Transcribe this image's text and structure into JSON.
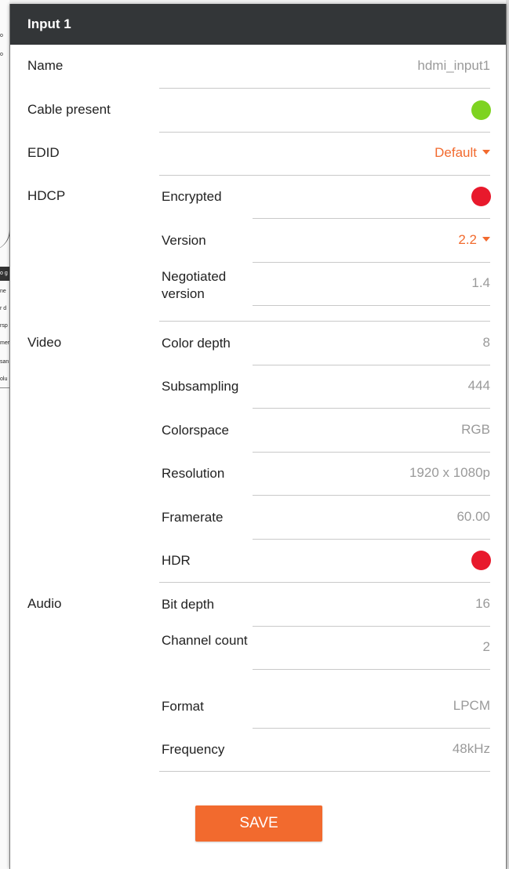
{
  "background": {
    "fragments": [
      "o",
      "o",
      "o g",
      "ne",
      "r d",
      "rsp",
      "mer",
      "san",
      "olu"
    ]
  },
  "panel": {
    "title": "Input 1"
  },
  "fields": {
    "name": {
      "label": "Name",
      "value": "hdmi_input1"
    },
    "cable_present": {
      "label": "Cable present",
      "status_color": "#7ed321"
    },
    "edid": {
      "label": "EDID",
      "value": "Default"
    }
  },
  "hdcp": {
    "section_label": "HDCP",
    "encrypted": {
      "label": "Encrypted",
      "status_color": "#e8192c"
    },
    "version": {
      "label": "Version",
      "value": "2.2"
    },
    "negotiated_version": {
      "label": "Negotiated version",
      "value": "1.4"
    }
  },
  "video": {
    "section_label": "Video",
    "color_depth": {
      "label": "Color depth",
      "value": "8"
    },
    "subsampling": {
      "label": "Subsampling",
      "value": "444"
    },
    "colorspace": {
      "label": "Colorspace",
      "value": "RGB"
    },
    "resolution": {
      "label": "Resolution",
      "value": "1920 x 1080p"
    },
    "framerate": {
      "label": "Framerate",
      "value": "60.00"
    },
    "hdr": {
      "label": "HDR",
      "status_color": "#e8192c"
    }
  },
  "audio": {
    "section_label": "Audio",
    "bit_depth": {
      "label": "Bit depth",
      "value": "16"
    },
    "channel_count": {
      "label": "Channel count",
      "value": "2"
    },
    "format": {
      "label": "Format",
      "value": "LPCM"
    },
    "frequency": {
      "label": "Frequency",
      "value": "48kHz"
    }
  },
  "actions": {
    "save_label": "SAVE"
  },
  "colors": {
    "header_bg": "#333638",
    "accent": "#f26a2e",
    "ok": "#7ed321",
    "error": "#e8192c",
    "value_text": "#9a9a9a"
  }
}
